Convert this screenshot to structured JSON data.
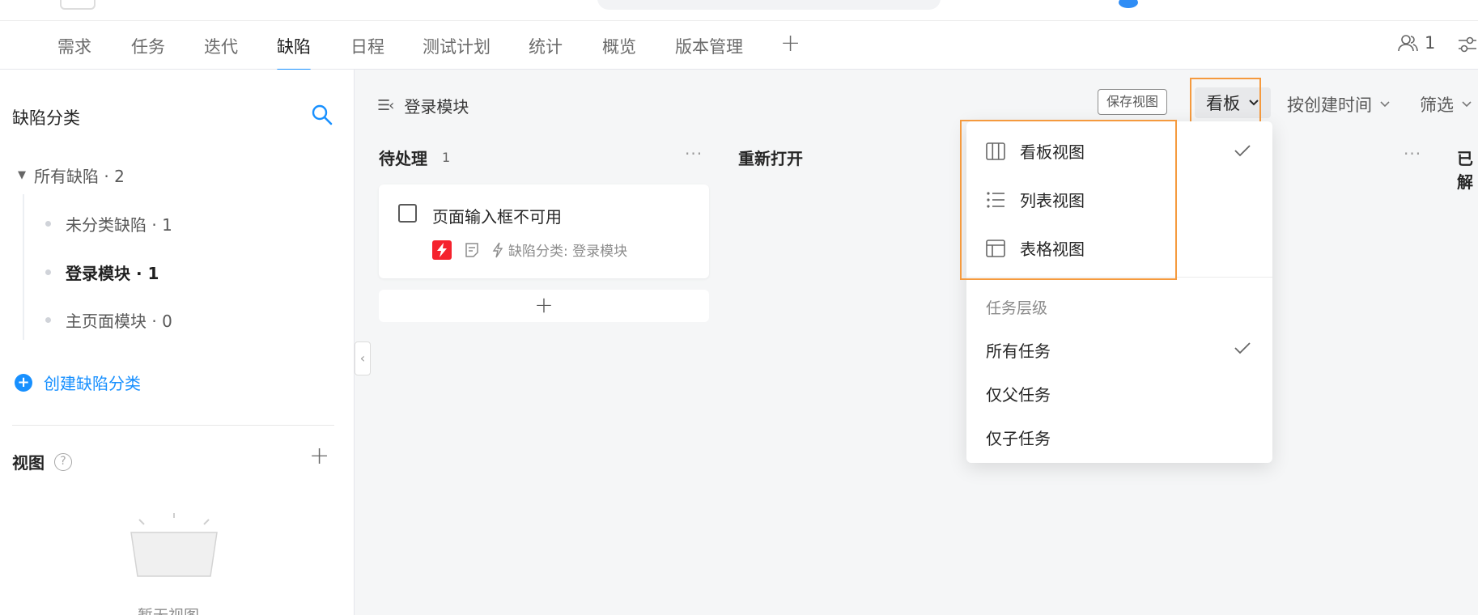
{
  "tabs": [
    {
      "label": "需求"
    },
    {
      "label": "任务"
    },
    {
      "label": "迭代"
    },
    {
      "label": "缺陷",
      "active": true
    },
    {
      "label": "日程"
    },
    {
      "label": "测试计划"
    },
    {
      "label": "统计"
    },
    {
      "label": "概览"
    },
    {
      "label": "版本管理"
    }
  ],
  "tabs_add": "+",
  "members_count": "1",
  "sidebar": {
    "title": "缺陷分类",
    "root": "所有缺陷 · 2",
    "items": [
      {
        "label": "未分类缺陷 · 1"
      },
      {
        "label": "登录模块 · 1",
        "selected": true
      },
      {
        "label": "主页面模块 · 0"
      }
    ],
    "create_label": "创建缺陷分类",
    "views_title": "视图",
    "views_help": "?",
    "views_add": "+",
    "empty_text": "暂无视图"
  },
  "toolbar": {
    "breadcrumb": "登录模块",
    "save_view": "保存视图",
    "view_switch": "看板",
    "sort": "按创建时间",
    "filter": "筛选"
  },
  "columns": [
    {
      "title": "待处理",
      "count": "1",
      "more": "···"
    },
    {
      "title": "重新打开",
      "more": "···"
    },
    {
      "title": "已解"
    }
  ],
  "card": {
    "title": "页面输入框不可用",
    "category": "缺陷分类: 登录模块"
  },
  "add_card": "+",
  "dropdown": {
    "views": [
      {
        "label": "看板视图",
        "icon": "board-view-icon",
        "checked": true
      },
      {
        "label": "列表视图",
        "icon": "list-view-icon"
      },
      {
        "label": "表格视图",
        "icon": "table-view-icon"
      }
    ],
    "group_title": "任务层级",
    "levels": [
      {
        "label": "所有任务",
        "checked": true
      },
      {
        "label": "仅父任务"
      },
      {
        "label": "仅子任务"
      }
    ]
  },
  "colors": {
    "accent": "#1890ff",
    "highlight": "#f59a3e",
    "danger": "#f5222d"
  }
}
